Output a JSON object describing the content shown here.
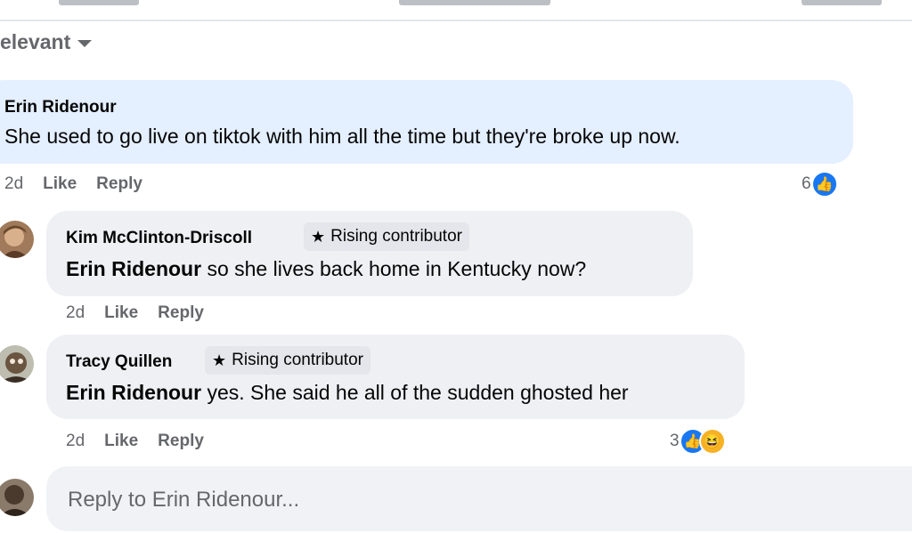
{
  "sort": {
    "label": "elevant"
  },
  "comments": [
    {
      "author": "Erin Ridenour",
      "text": "She used to go live on tiktok with him all the time but they're broke up now.",
      "time": "2d",
      "like_label": "Like",
      "reply_label": "Reply",
      "reaction_count": "6"
    },
    {
      "author": "Kim McClinton-Driscoll",
      "badge": "Rising contributor",
      "mention": "Erin Ridenour",
      "text": " so she lives back home in Kentucky now?",
      "time": "2d",
      "like_label": "Like",
      "reply_label": "Reply"
    },
    {
      "author": "Tracy Quillen",
      "badge": "Rising contributor",
      "mention": "Erin Ridenour",
      "text": " yes. She said he all of the sudden ghosted her",
      "time": "2d",
      "like_label": "Like",
      "reply_label": "Reply",
      "reaction_count": "3"
    }
  ],
  "reply_box": {
    "placeholder": "Reply to Erin Ridenour..."
  },
  "colors": {
    "accent": "#1877f2",
    "highlight_bubble": "#e4efff",
    "bubble": "#eef0f3",
    "muted_text": "#65676b"
  },
  "icons": {
    "like_reaction": "thumbs-up-icon",
    "haha_reaction": "laughing-face-icon",
    "badge": "star-icon",
    "sort": "chevron-down-icon"
  }
}
